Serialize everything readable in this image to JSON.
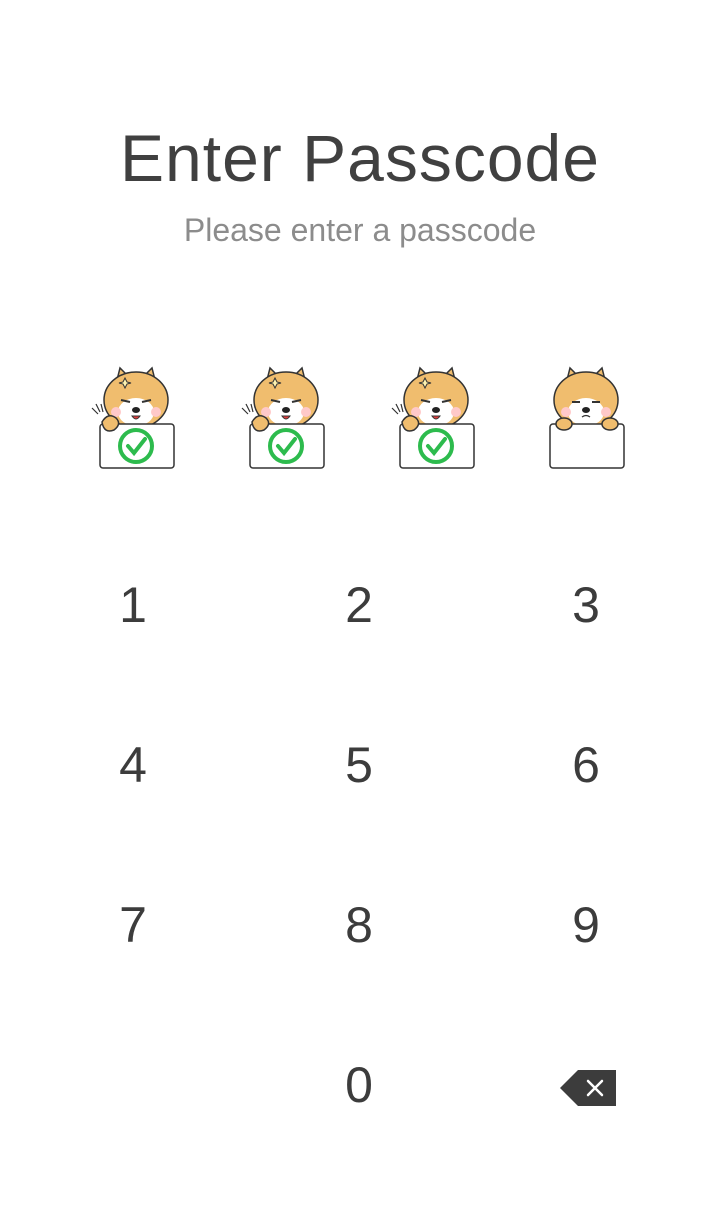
{
  "header": {
    "title": "Enter Passcode",
    "subtitle": "Please enter a passcode"
  },
  "passcode": {
    "length": 4,
    "entered": 3,
    "slots": [
      {
        "state": "filled",
        "icon": "shiba-check-icon"
      },
      {
        "state": "filled",
        "icon": "shiba-check-icon"
      },
      {
        "state": "filled",
        "icon": "shiba-check-icon"
      },
      {
        "state": "empty",
        "icon": "shiba-blank-sign-icon"
      }
    ]
  },
  "keypad": {
    "k1": "1",
    "k2": "2",
    "k3": "3",
    "k4": "4",
    "k5": "5",
    "k6": "6",
    "k7": "7",
    "k8": "8",
    "k9": "9",
    "k0": "0",
    "delete_icon": "backspace-icon"
  },
  "colors": {
    "check": "#2dbb4d",
    "dog_fur": "#f0bd6e",
    "text": "#404040",
    "subtext": "#8c8c8c",
    "backspace": "#3c3c3c"
  }
}
